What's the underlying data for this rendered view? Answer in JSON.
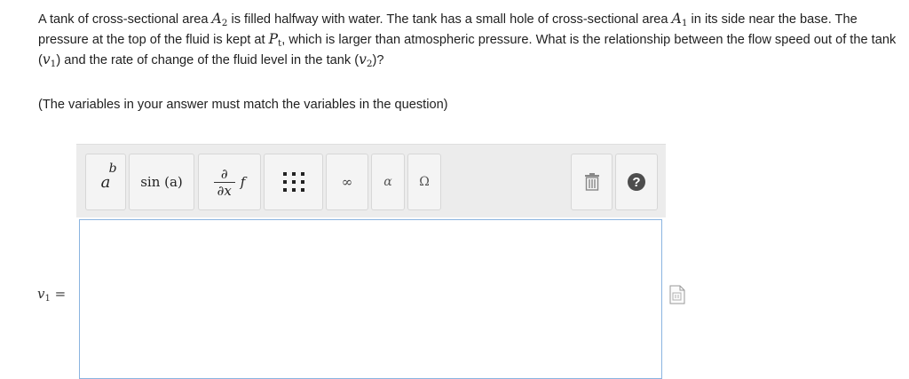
{
  "question": {
    "text_1": "A tank of cross-sectional area ",
    "A2_letter": "A",
    "A2_sub": "2",
    "text_2": " is filled halfway with water. The tank has a small hole of cross-sectional area ",
    "A1_letter": "A",
    "A1_sub": "1",
    "text_3": " in its side near the base. The pressure at the top of the fluid is kept at ",
    "Pt_letter": "P",
    "Pt_sub": "t",
    "text_4": ", which is larger than atmospheric pressure. What is the relationship between the flow speed out of the tank (",
    "v1_letter": "v",
    "v1_sub": "1",
    "text_5": ") and the rate of change of the fluid level in the tank (",
    "v2_letter": "v",
    "v2_sub": "2",
    "text_6": ")?"
  },
  "note": "(The variables in your answer must match the variables in the question)",
  "toolbar": {
    "power": {
      "base": "a",
      "exp": "b"
    },
    "sin_label": "sin (a)",
    "derivative": {
      "num": "∂",
      "den": "∂x",
      "f": "f"
    },
    "infinity": "∞",
    "alpha": "α",
    "omega": "Ω",
    "help": "?"
  },
  "answer": {
    "label_var": "v",
    "label_sub": "1",
    "label_eq": " =",
    "value": ""
  },
  "colors": {
    "toolbar_bg": "#ececec",
    "button_bg": "#f4f4f4",
    "input_border": "#8ab4e0",
    "help_bg": "#4d4d4d"
  },
  "icons": [
    "power-icon",
    "sin-icon",
    "derivative-icon",
    "matrix-icon",
    "infinity-icon",
    "alpha-icon",
    "omega-icon",
    "trash-icon",
    "help-icon",
    "document-icon"
  ]
}
